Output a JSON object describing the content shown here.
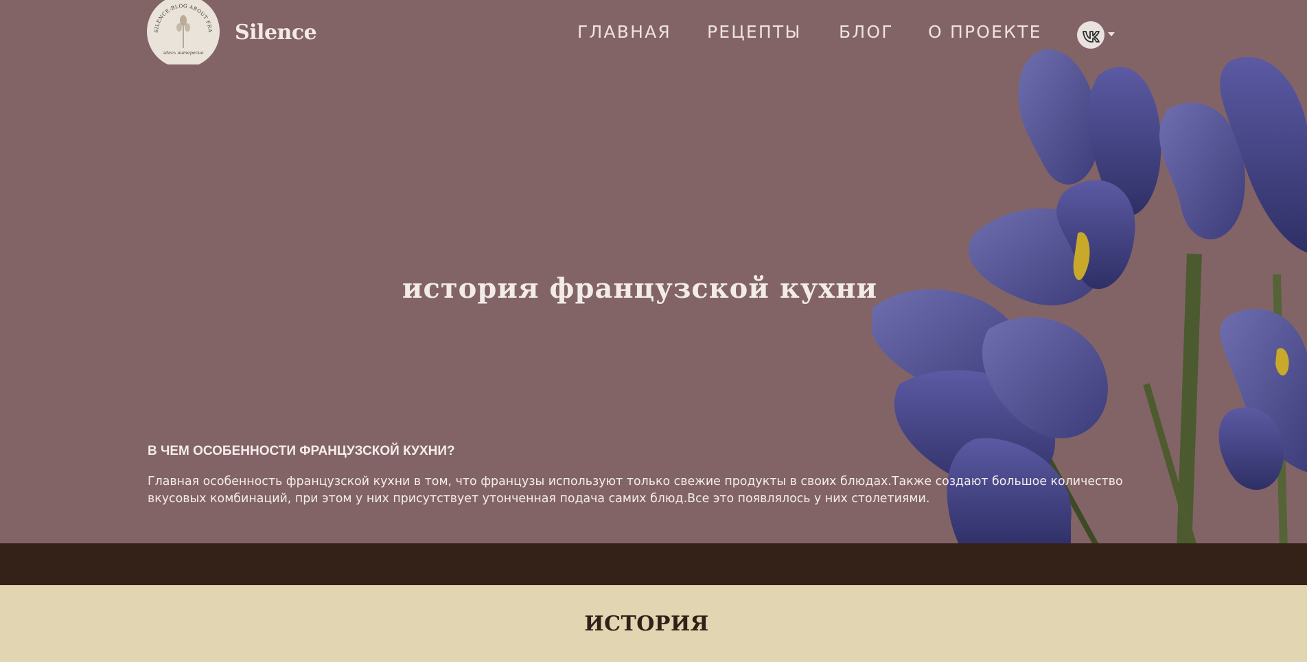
{
  "header": {
    "brand": "Silence",
    "logo": {
      "ring_text": "SILENCE-BLOG ABOUT FRANCE",
      "tagline": "здесь интересно"
    },
    "nav": [
      "ГЛАВНАЯ",
      "РЕЦЕПТЫ",
      "БЛОГ",
      "О ПРОЕКТЕ"
    ],
    "social": {
      "icon": "vk-icon",
      "menu_icon": "caret-down-icon"
    }
  },
  "hero": {
    "title": "история французской кухни",
    "question": "В ЧЕМ ОСОБЕННОСТИ ФРАНЦУЗСКОЙ КУХНИ?",
    "text": "Главная особенность французской кухни в том, что французы используют только свежие продукты в своих блюдах.Также создают большое количество вкусовых комбинаций, при этом у них присутствует утонченная подача самих блюд.Все это появлялось у них столетиями.",
    "image": "iris-flowers"
  },
  "section": {
    "title": "ИСТОРИЯ"
  },
  "colors": {
    "hero_bg": "#826466",
    "band_bg": "#342218",
    "section_bg": "#e2d5b1",
    "iris": "#4f4f93"
  }
}
